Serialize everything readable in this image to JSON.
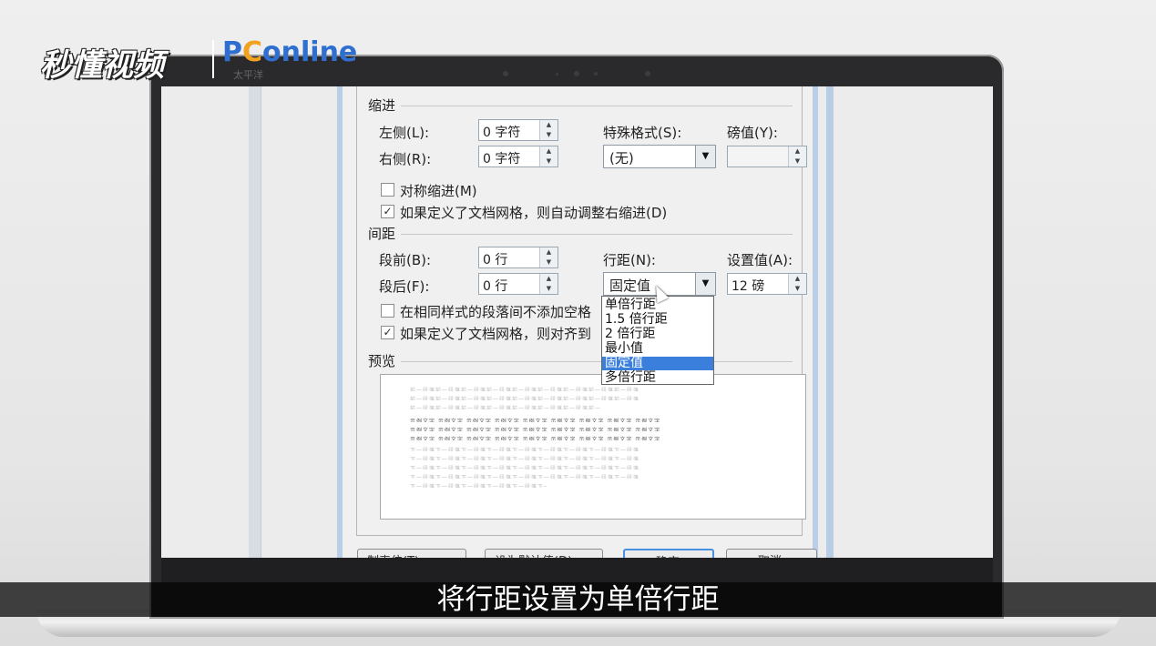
{
  "logo": {
    "brand_left": "秒懂视频",
    "brand_right_p": "P",
    "brand_right_c": "C",
    "brand_right_rest": "online",
    "brand_sub": "太平洋"
  },
  "dialog": {
    "indent": {
      "section": "缩进",
      "left_label": "左侧(L):",
      "left_value": "0 字符",
      "right_label": "右侧(R):",
      "right_value": "0 字符",
      "special_label": "特殊格式(S):",
      "special_value": "(无)",
      "by_label": "磅值(Y):",
      "by_value": "",
      "mirror_label": "对称缩进(M)",
      "mirror_checked": false,
      "auto_right_label": "如果定义了文档网格，则自动调整右缩进(D)",
      "auto_right_checked": true
    },
    "spacing": {
      "section": "间距",
      "before_label": "段前(B):",
      "before_value": "0 行",
      "after_label": "段后(F):",
      "after_value": "0 行",
      "line_label": "行距(N):",
      "line_value": "固定值",
      "at_label": "设置值(A):",
      "at_value": "12 磅",
      "no_space_label": "在相同样式的段落间不添加空格",
      "no_space_checked": false,
      "snap_grid_label": "如果定义了文档网格，则对齐到",
      "snap_grid_checked": true
    },
    "line_spacing_options": [
      "单倍行距",
      "1.5 倍行距",
      "2 倍行距",
      "最小值",
      "固定值",
      "多倍行距"
    ],
    "line_spacing_selected": "固定值",
    "preview": {
      "section": "预览",
      "prev_text": "前一段落前一段落前一段落前一段落前一段落前一段落前一段落前一段落前一段落",
      "sample_text": "示例文字 示例文字 示例文字 示例文字 示例文字 示例文字 示例文字 示例文字 示例文字",
      "next_text": "下一段落下一段落下一段落下一段落下一段落下一段落下一段落下一段落下一段落"
    },
    "buttons": {
      "tabs": "制表位(T)...",
      "default": "设为默认值(D)",
      "ok": "确定",
      "cancel": "取消"
    }
  },
  "subtitle": "将行距设置为单倍行距"
}
